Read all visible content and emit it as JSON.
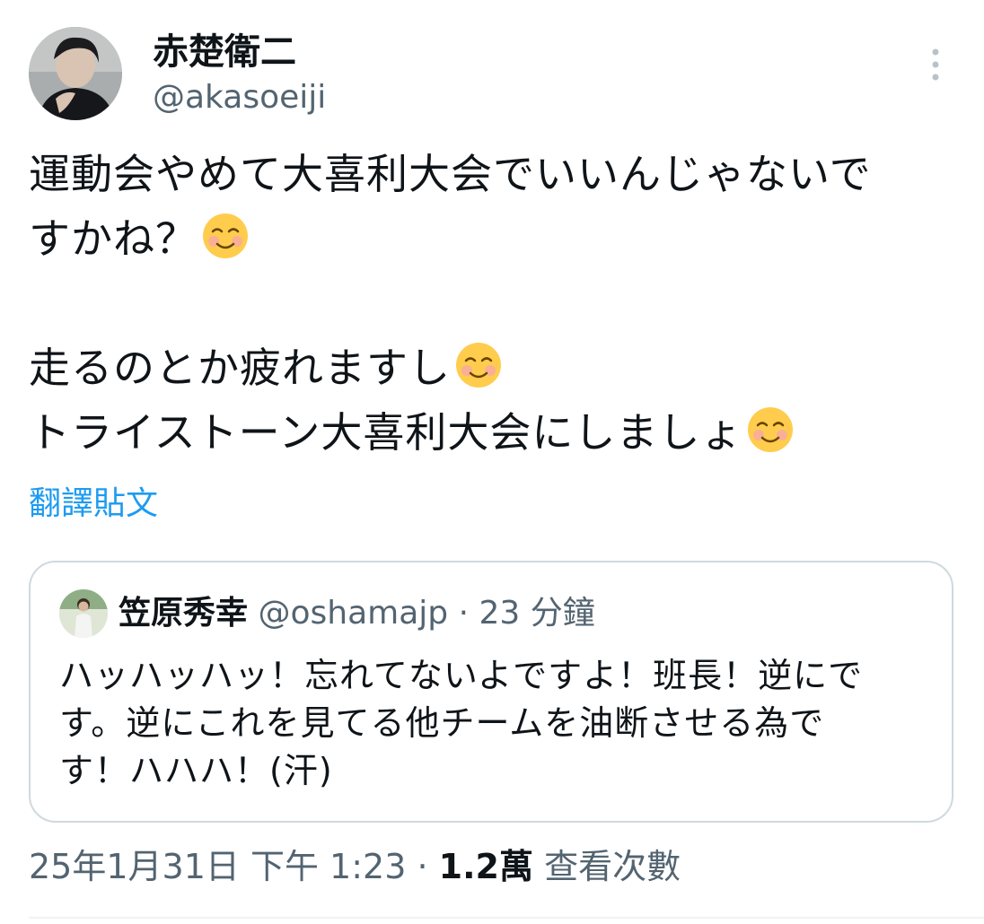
{
  "author": {
    "display_name": "赤楚衛二",
    "handle": "@akasoeiji"
  },
  "post": {
    "lines": [
      "運動会やめて大喜利大会でいいんじゃないで",
      "すかね？",
      "",
      "走るのとか疲れますし",
      "トライストーン大喜利大会にしましょ"
    ],
    "emoji_icon": "smiling-face-with-smiling-eyes-emoji"
  },
  "translate_label": "翻譯貼文",
  "quoted_post": {
    "display_name": "笠原秀幸",
    "handle": "@oshamajp",
    "separator": "·",
    "time": "23 分鐘",
    "lines": [
      "ハッハッハッ！忘れてないよですよ！班長！逆にで",
      "す。逆にこれを見てる他チームを油断させる為で",
      "す！ハハハ！(汗)"
    ]
  },
  "meta": {
    "timestamp": "25年1月31日 下午 1:23",
    "separator": "·",
    "views_count": "1.2萬",
    "views_label": "查看次數"
  },
  "colors": {
    "text": "#0f1419",
    "secondary": "#536471",
    "link": "#1d9bf0",
    "border": "#cfd9de"
  }
}
